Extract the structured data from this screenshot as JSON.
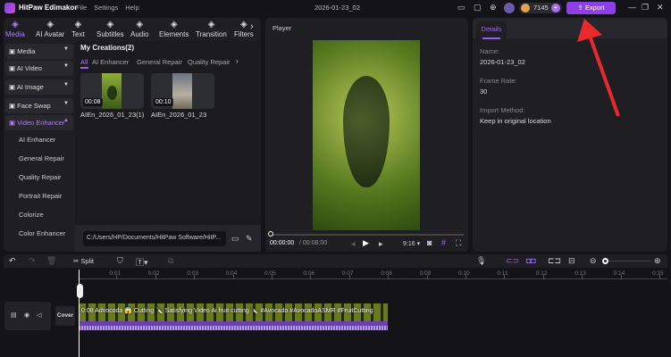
{
  "app": {
    "title": "HitPaw Edimakor",
    "menu": [
      "File",
      "Settings",
      "Help"
    ],
    "project": "2026-01-23_02",
    "coins": "7145",
    "export": "Export"
  },
  "tabs": [
    {
      "label": "Media",
      "icon": "media-icon"
    },
    {
      "label": "AI Avatar",
      "icon": "avatar-icon"
    },
    {
      "label": "Text",
      "icon": "text-icon"
    },
    {
      "label": "Subtitles",
      "icon": "subtitles-icon"
    },
    {
      "label": "Audio",
      "icon": "audio-icon"
    },
    {
      "label": "Elements",
      "icon": "elements-icon"
    },
    {
      "label": "Transition",
      "icon": "transition-icon"
    },
    {
      "label": "Filters",
      "icon": "filters-icon"
    }
  ],
  "sidebar": {
    "items": [
      "Media",
      "AI Video",
      "AI Image",
      "Face Swap",
      "Video Enhancer"
    ],
    "subitems": [
      "AI Enhancer",
      "General Repair",
      "Quality Repair",
      "Portrait Repair",
      "Colorize",
      "Color Enhancer"
    ]
  },
  "library": {
    "title": "My Creations(2)",
    "filters": [
      "All",
      "AI Enhancer",
      "General Repair",
      "Quality Repair"
    ],
    "items": [
      {
        "name": "AIEn_2026_01_23(1)",
        "duration": "00:08"
      },
      {
        "name": "AIEn_2026_01_23",
        "duration": "00:10"
      }
    ],
    "path": "C:/Users/HP/Documents/HitPaw Software/HitP..."
  },
  "player": {
    "title": "Player",
    "current": "00:00:00",
    "total": "/ 00:08:00",
    "ratio": "9:16",
    "progress": 0
  },
  "details": {
    "tab": "Details",
    "fields": [
      {
        "label": "Name:",
        "value": "2026-01-23_02"
      },
      {
        "label": "Frame Rate:",
        "value": "30"
      },
      {
        "label": "Import Method:",
        "value": "Keep in original location"
      }
    ]
  },
  "timeline": {
    "split": "Split",
    "cover": "Cover",
    "ticks": [
      "0:01",
      "0:02",
      "0:03",
      "0:04",
      "0:05",
      "0:06",
      "0:07",
      "0:08",
      "0:09",
      "0:10",
      "0:11",
      "0:12",
      "0:13",
      "0:14",
      "0:15"
    ],
    "clip": "0:08 Advocoda 😱 Cutting 🔪 Satisfying Video Ai fruit cutting 🔪 #Avocado #AvocadoASMR #FruitCutting"
  },
  "colors": {
    "accent": "#9b5cf0",
    "export": "#8e3fe8",
    "arrow": "#e82a2a"
  }
}
